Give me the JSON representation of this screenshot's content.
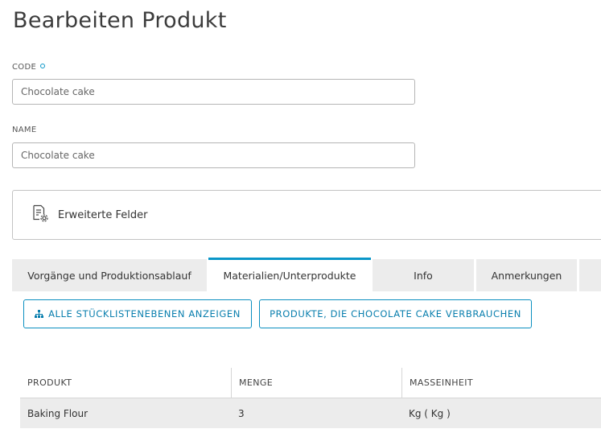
{
  "page": {
    "title": "Bearbeiten Produkt"
  },
  "form": {
    "code": {
      "label": "CODE",
      "value": "Chocolate cake"
    },
    "name": {
      "label": "NAME",
      "value": "Chocolate cake"
    }
  },
  "advanced": {
    "label": "Erweiterte Felder"
  },
  "tabs": [
    {
      "label": "Vorgänge und Produktionsablauf"
    },
    {
      "label": "Materialien/Unterprodukte"
    },
    {
      "label": "Info"
    },
    {
      "label": "Anmerkungen"
    },
    {
      "label": ""
    }
  ],
  "active_tab": "Materialien/Unterprodukte",
  "actions": {
    "show_bom_levels": "ALLE STÜCKLISTENEBENEN ANZEIGEN",
    "consuming_products": "PRODUKTE, DIE CHOCOLATE CAKE VERBRAUCHEN"
  },
  "table": {
    "columns": [
      "PRODUKT",
      "MENGE",
      "MASSEINHEIT"
    ],
    "rows": [
      [
        "Baking Flour",
        "3",
        "Kg ( Kg )"
      ]
    ]
  },
  "colors": {
    "accent": "#0a96c8",
    "tab_bg": "#ececec",
    "row_bg": "#ececec"
  }
}
